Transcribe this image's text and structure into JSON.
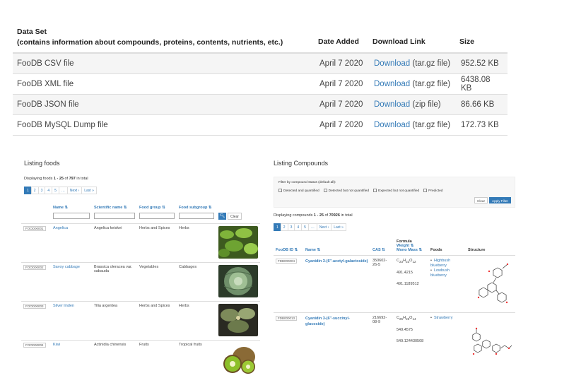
{
  "dataset": {
    "header": {
      "col1_line1": "Data Set",
      "col1_line2": "(contains information about compounds, proteins, contents, nutrients, etc.)",
      "col2": "Date Added",
      "col3": "Download Link",
      "col4": "Size"
    },
    "rows": [
      {
        "name": "FooDB CSV file",
        "date": "April 7 2020",
        "link": "Download",
        "type": "(tar.gz file)",
        "size": "952.52 KB"
      },
      {
        "name": "FooDB XML file",
        "date": "April 7 2020",
        "link": "Download",
        "type": "(tar.gz file)",
        "size": "6438.08 KB"
      },
      {
        "name": "FooDB JSON file",
        "date": "April 7 2020",
        "link": "Download",
        "type": "(zip file)",
        "size": "86.66 KB"
      },
      {
        "name": "FooDB MySQL Dump file",
        "date": "April 7 2020",
        "link": "Download",
        "type": "(tar.gz file)",
        "size": "172.73 KB"
      }
    ]
  },
  "foods": {
    "title": "Listing foods",
    "count_prefix": "Displaying foods",
    "count_range": "1 - 25",
    "count_of": "of",
    "count_total": "797",
    "count_suffix": "in total",
    "pager": [
      "1",
      "2",
      "3",
      "4",
      "5",
      "…",
      "Next ›",
      "Last »"
    ],
    "columns": [
      "Name ⇅",
      "Scientific name ⇅",
      "Food group ⇅",
      "Food subgroup ⇅"
    ],
    "clear_label": "Clear",
    "rows": [
      {
        "id": "FOOD00001",
        "name": "Angelica",
        "scientific": "Angelica keiskei",
        "group": "Herbs and Spices",
        "subgroup": "Herbs",
        "image": "angelica"
      },
      {
        "id": "FOOD00002",
        "name": "Savoy cabbage",
        "scientific": "Brassica oleracea var. sabauda",
        "group": "Vegetables",
        "subgroup": "Cabbages",
        "image": "cabbage"
      },
      {
        "id": "FOOD00003",
        "name": "Silver linden",
        "scientific": "Tilia argentea",
        "group": "Herbs and Spices",
        "subgroup": "Herbs",
        "image": "linden"
      },
      {
        "id": "FOOD00004",
        "name": "Kiwi",
        "scientific": "Actinidia chinensis",
        "group": "Fruits",
        "subgroup": "Tropical fruits",
        "image": "kiwi"
      }
    ]
  },
  "compounds": {
    "title": "Listing Compounds",
    "filter_label": "Filter by compound status (default all):",
    "filters": [
      "Detected  and quantified",
      "Detected but not quantified",
      "Expected but not quantified",
      "Predicted"
    ],
    "clear_label": "Clear",
    "apply_label": "Apply Filter",
    "count_prefix": "Displaying compounds",
    "count_range": "1 - 25",
    "count_of": "of",
    "count_total": "70926",
    "count_suffix": "in total",
    "pager": [
      "1",
      "2",
      "3",
      "4",
      "5",
      "…",
      "Next ›",
      "Last »"
    ],
    "columns": {
      "id": "FooDB ID ⇅",
      "name": "Name ⇅",
      "cas": "CAS ⇅",
      "formula": "Formula",
      "weight": "Weight ⇅",
      "mono": "Mono Mass ⇅",
      "foods": "Foods",
      "structure": "Structure"
    },
    "rows": [
      {
        "id": "FDB000004",
        "name": "Cyanidin 3-(6''-acetyl-galactoside)",
        "cas": "350602-26-5",
        "formula": "C23H23O12",
        "weight": "491.4215",
        "mono": "491.1189512",
        "foods": [
          "Highbush blueberry",
          "Lowbush blueberry"
        ]
      },
      {
        "id": "FDB000013",
        "name": "Cyanidin 3-(6''-succinyl-glucoside)",
        "cas": "216692-08-9",
        "formula": "C25H25O14",
        "weight": "549.4575",
        "mono": "549.124430508",
        "foods": [
          "Strawberry"
        ]
      }
    ]
  }
}
